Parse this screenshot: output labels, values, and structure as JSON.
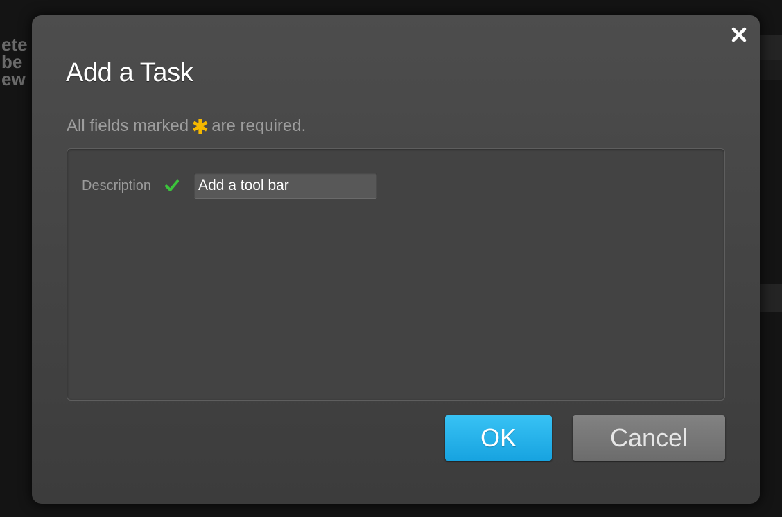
{
  "background": {
    "partial_text": "ete\nbe\new"
  },
  "dialog": {
    "title": "Add a Task",
    "close_icon": "close-icon",
    "required_note": {
      "prefix": "All fields marked",
      "marker": "✱",
      "suffix": "are required."
    },
    "fields": [
      {
        "label": "Description",
        "status_icon": "check-icon",
        "value": "Add a tool bar",
        "valid": true
      }
    ],
    "buttons": {
      "ok_label": "OK",
      "cancel_label": "Cancel"
    },
    "colors": {
      "accent": "#1ba9e6",
      "required_marker": "#f5b800",
      "valid_check": "#3cc43c"
    }
  }
}
